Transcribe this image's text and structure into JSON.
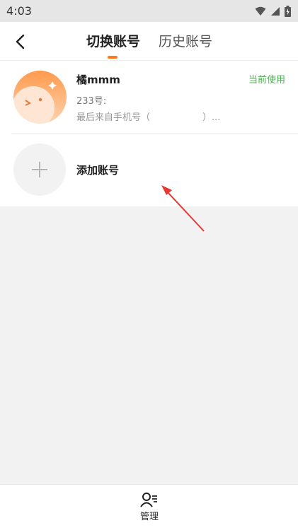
{
  "status_bar": {
    "time": "4:03"
  },
  "header": {
    "tabs": [
      {
        "label": "切换账号",
        "active": true
      },
      {
        "label": "历史账号",
        "active": false
      }
    ]
  },
  "accounts": [
    {
      "name": "橘mmm",
      "id_label": "233号:",
      "last_login_prefix": "最后来自手机号（",
      "last_login_suffix": "）...",
      "badge": "当前使用"
    }
  ],
  "add_account": {
    "label": "添加账号"
  },
  "bottom_bar": {
    "manage_label": "管理"
  },
  "colors": {
    "accent": "#ff7a1a",
    "current_badge": "#4caf50",
    "annotation_arrow": "#e53935"
  }
}
